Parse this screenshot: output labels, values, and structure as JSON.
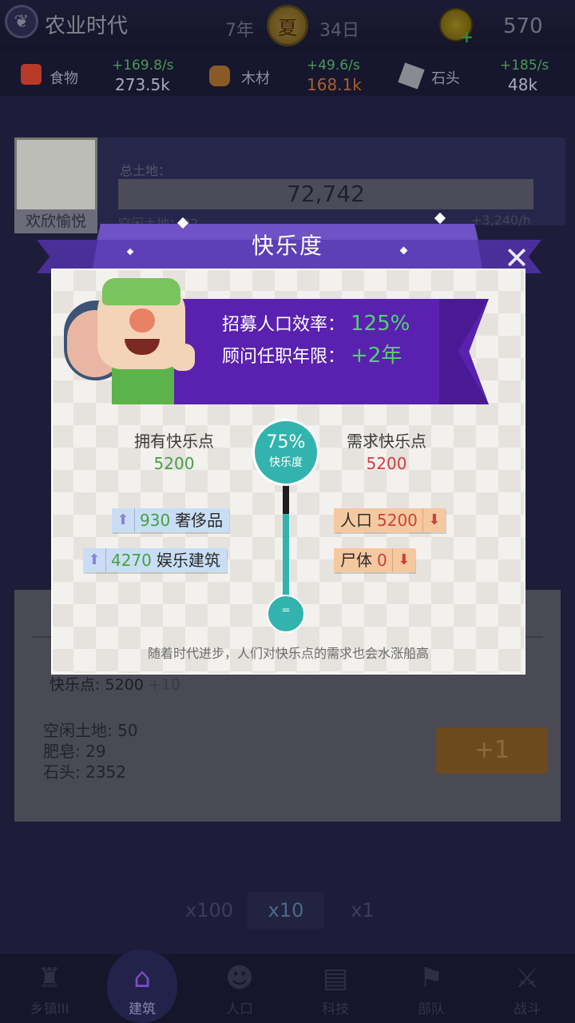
{
  "topbar": {
    "era_name": "农业时代",
    "year": "7年",
    "season": "夏",
    "day": "34日",
    "gems": "570"
  },
  "resources": [
    {
      "label": "食物",
      "rate": "+169.8/s",
      "value": "273.5k",
      "icon": "food-icon"
    },
    {
      "label": "木材",
      "rate": "+49.6/s",
      "value": "168.1k",
      "icon": "wood-icon"
    },
    {
      "label": "石头",
      "rate": "+185/s",
      "value": "48k",
      "icon": "stone-icon"
    }
  ],
  "background": {
    "advisor_label": "欢欣愉悦",
    "land_title": "总土地：",
    "land_value": "72,742",
    "land_sub_left": "空闲土地：92",
    "land_sub_right": "+3,240/h",
    "happy_line": "快乐点: 5200",
    "happy_plus": "+10",
    "info_idle": "空闲土地: 50",
    "info_soap": "肥皂: 29",
    "info_stone": "石头: 2352",
    "plus_button": "+1",
    "multipliers": [
      "x100",
      "x10",
      "x1"
    ]
  },
  "nav": [
    {
      "label": "乡镇III",
      "icon": "town-icon"
    },
    {
      "label": "建筑",
      "icon": "building-icon"
    },
    {
      "label": "人口",
      "icon": "population-icon"
    },
    {
      "label": "科技",
      "icon": "tech-book-icon"
    },
    {
      "label": "部队",
      "icon": "army-icon"
    },
    {
      "label": "战斗",
      "icon": "battle-swords-icon"
    }
  ],
  "dialog": {
    "title": "快乐度",
    "banner": {
      "recruit_label": "招募人口效率：",
      "recruit_value": "125%",
      "advisor_label": "顾问任职年限：",
      "advisor_value": "+2年"
    },
    "have": {
      "title": "拥有快乐点",
      "value": "5200"
    },
    "need": {
      "title": "需求快乐点",
      "value": "5200"
    },
    "gauge": {
      "percent_text": "75%",
      "label": "快乐度",
      "fill_fraction": 0.75
    },
    "sources": [
      {
        "value": "930",
        "label": "奢侈品"
      },
      {
        "value": "4270",
        "label": "娱乐建筑"
      }
    ],
    "demands": [
      {
        "label": "人口",
        "value": "5200"
      },
      {
        "label": "尸体",
        "value": "0"
      }
    ],
    "footnote": "随着时代进步，人们对快乐点的需求也会水涨船高"
  }
}
